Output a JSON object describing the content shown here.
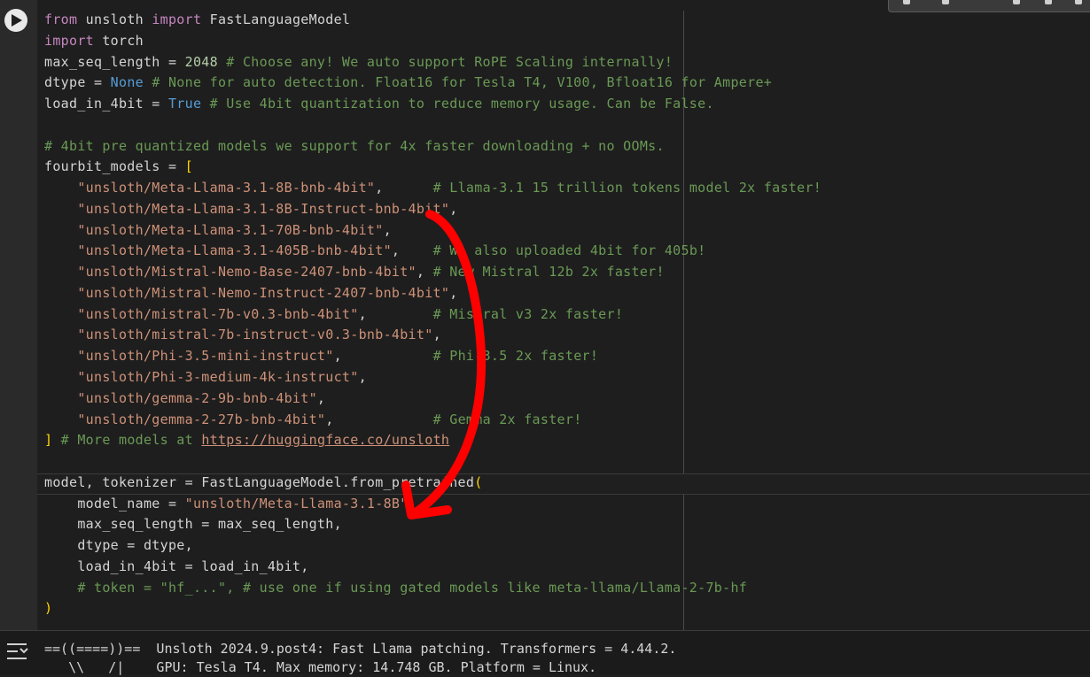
{
  "code_lines": [
    [
      {
        "t": "from",
        "c": "kw"
      },
      {
        "t": " unsloth "
      },
      {
        "t": "import",
        "c": "kw"
      },
      {
        "t": " FastLanguageModel"
      }
    ],
    [
      {
        "t": "import",
        "c": "kw"
      },
      {
        "t": " torch"
      }
    ],
    [
      {
        "t": "max_seq_length = "
      },
      {
        "t": "2048",
        "c": "num"
      },
      {
        "t": " # Choose any! We auto support RoPE Scaling internally!",
        "c": "cm"
      }
    ],
    [
      {
        "t": "dtype = "
      },
      {
        "t": "None",
        "c": "const"
      },
      {
        "t": " # None for auto detection. Float16 for Tesla T4, V100, Bfloat16 for Ampere+",
        "c": "cm"
      }
    ],
    [
      {
        "t": "load_in_4bit = "
      },
      {
        "t": "True",
        "c": "const"
      },
      {
        "t": " # Use 4bit quantization to reduce memory usage. Can be False.",
        "c": "cm"
      }
    ],
    [
      {
        "t": ""
      }
    ],
    [
      {
        "t": "# 4bit pre quantized models we support for 4x faster downloading + no OOMs.",
        "c": "cm"
      }
    ],
    [
      {
        "t": "fourbit_models = "
      },
      {
        "t": "[",
        "c": "brk"
      }
    ],
    [
      {
        "t": "    "
      },
      {
        "t": "\"unsloth/Meta-Llama-3.1-8B-bnb-4bit\"",
        "c": "str"
      },
      {
        "t": ",      "
      },
      {
        "t": "# Llama-3.1 15 trillion tokens model 2x faster!",
        "c": "cm"
      }
    ],
    [
      {
        "t": "    "
      },
      {
        "t": "\"unsloth/Meta-Llama-3.1-8B-Instruct-bnb-4bit\"",
        "c": "str"
      },
      {
        "t": ","
      }
    ],
    [
      {
        "t": "    "
      },
      {
        "t": "\"unsloth/Meta-Llama-3.1-70B-bnb-4bit\"",
        "c": "str"
      },
      {
        "t": ","
      }
    ],
    [
      {
        "t": "    "
      },
      {
        "t": "\"unsloth/Meta-Llama-3.1-405B-bnb-4bit\"",
        "c": "str"
      },
      {
        "t": ",    "
      },
      {
        "t": "# We also uploaded 4bit for 405b!",
        "c": "cm"
      }
    ],
    [
      {
        "t": "    "
      },
      {
        "t": "\"unsloth/Mistral-Nemo-Base-2407-bnb-4bit\"",
        "c": "str"
      },
      {
        "t": ", "
      },
      {
        "t": "# New Mistral 12b 2x faster!",
        "c": "cm"
      }
    ],
    [
      {
        "t": "    "
      },
      {
        "t": "\"unsloth/Mistral-Nemo-Instruct-2407-bnb-4bit\"",
        "c": "str"
      },
      {
        "t": ","
      }
    ],
    [
      {
        "t": "    "
      },
      {
        "t": "\"unsloth/mistral-7b-v0.3-bnb-4bit\"",
        "c": "str"
      },
      {
        "t": ",        "
      },
      {
        "t": "# Mistral v3 2x faster!",
        "c": "cm"
      }
    ],
    [
      {
        "t": "    "
      },
      {
        "t": "\"unsloth/mistral-7b-instruct-v0.3-bnb-4bit\"",
        "c": "str"
      },
      {
        "t": ","
      }
    ],
    [
      {
        "t": "    "
      },
      {
        "t": "\"unsloth/Phi-3.5-mini-instruct\"",
        "c": "str"
      },
      {
        "t": ",           "
      },
      {
        "t": "# Phi-3.5 2x faster!",
        "c": "cm"
      }
    ],
    [
      {
        "t": "    "
      },
      {
        "t": "\"unsloth/Phi-3-medium-4k-instruct\"",
        "c": "str"
      },
      {
        "t": ","
      }
    ],
    [
      {
        "t": "    "
      },
      {
        "t": "\"unsloth/gemma-2-9b-bnb-4bit\"",
        "c": "str"
      },
      {
        "t": ","
      }
    ],
    [
      {
        "t": "    "
      },
      {
        "t": "\"unsloth/gemma-2-27b-bnb-4bit\"",
        "c": "str"
      },
      {
        "t": ",            "
      },
      {
        "t": "# Gemma 2x faster!",
        "c": "cm"
      }
    ],
    [
      {
        "t": "]",
        "c": "brk"
      },
      {
        "t": " # More models at ",
        "c": "cm"
      },
      {
        "t": "https://huggingface.co/unsloth",
        "c": "link"
      }
    ],
    [
      {
        "t": ""
      }
    ],
    [
      {
        "t": "model, tokenizer = FastLanguageModel.from_pretrained"
      },
      {
        "t": "(",
        "c": "brk"
      }
    ],
    [
      {
        "t": "    model_name = "
      },
      {
        "t": "\"unsloth/Meta-Llama-3.1-8B\"",
        "c": "str"
      },
      {
        "t": ","
      }
    ],
    [
      {
        "t": "    max_seq_length = max_seq_length,"
      }
    ],
    [
      {
        "t": "    dtype = dtype,"
      }
    ],
    [
      {
        "t": "    load_in_4bit = load_in_4bit,"
      }
    ],
    [
      {
        "t": "    # token = \"hf_...\", # use one if using gated models like meta-llama/Llama-2-7b-hf",
        "c": "cm"
      }
    ],
    [
      {
        "t": ")",
        "c": "brk"
      }
    ]
  ],
  "output": {
    "lines": [
      "==((====))==  Unsloth 2024.9.post4: Fast Llama patching. Transformers = 4.44.2.",
      "   \\\\   /|    GPU: Tesla T4. Max memory: 14.748 GB. Platform = Linux."
    ]
  },
  "icons": {
    "run": "play-icon",
    "output_toggle": "output-toggle-icon"
  },
  "colors": {
    "annotation_arrow": "#ff0000",
    "keyword": "#c586c0",
    "string": "#ce9178",
    "comment": "#6a9955",
    "constant": "#569cd6"
  }
}
